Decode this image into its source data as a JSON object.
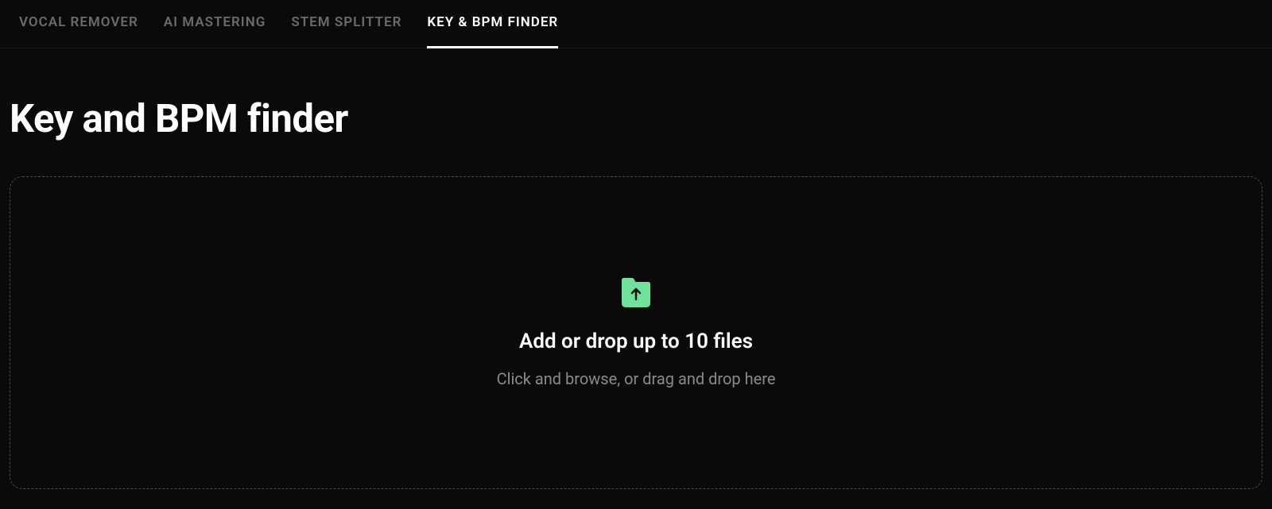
{
  "nav": {
    "tabs": [
      {
        "label": "VOCAL REMOVER",
        "active": false
      },
      {
        "label": "AI MASTERING",
        "active": false
      },
      {
        "label": "STEM SPLITTER",
        "active": false
      },
      {
        "label": "KEY & BPM FINDER",
        "active": true
      }
    ]
  },
  "page": {
    "title": "Key and BPM finder"
  },
  "dropzone": {
    "title": "Add or drop up to 10 files",
    "subtitle": "Click and browse, or drag and drop here",
    "icon": "folder-upload-icon",
    "icon_color": "#6fe39b"
  }
}
